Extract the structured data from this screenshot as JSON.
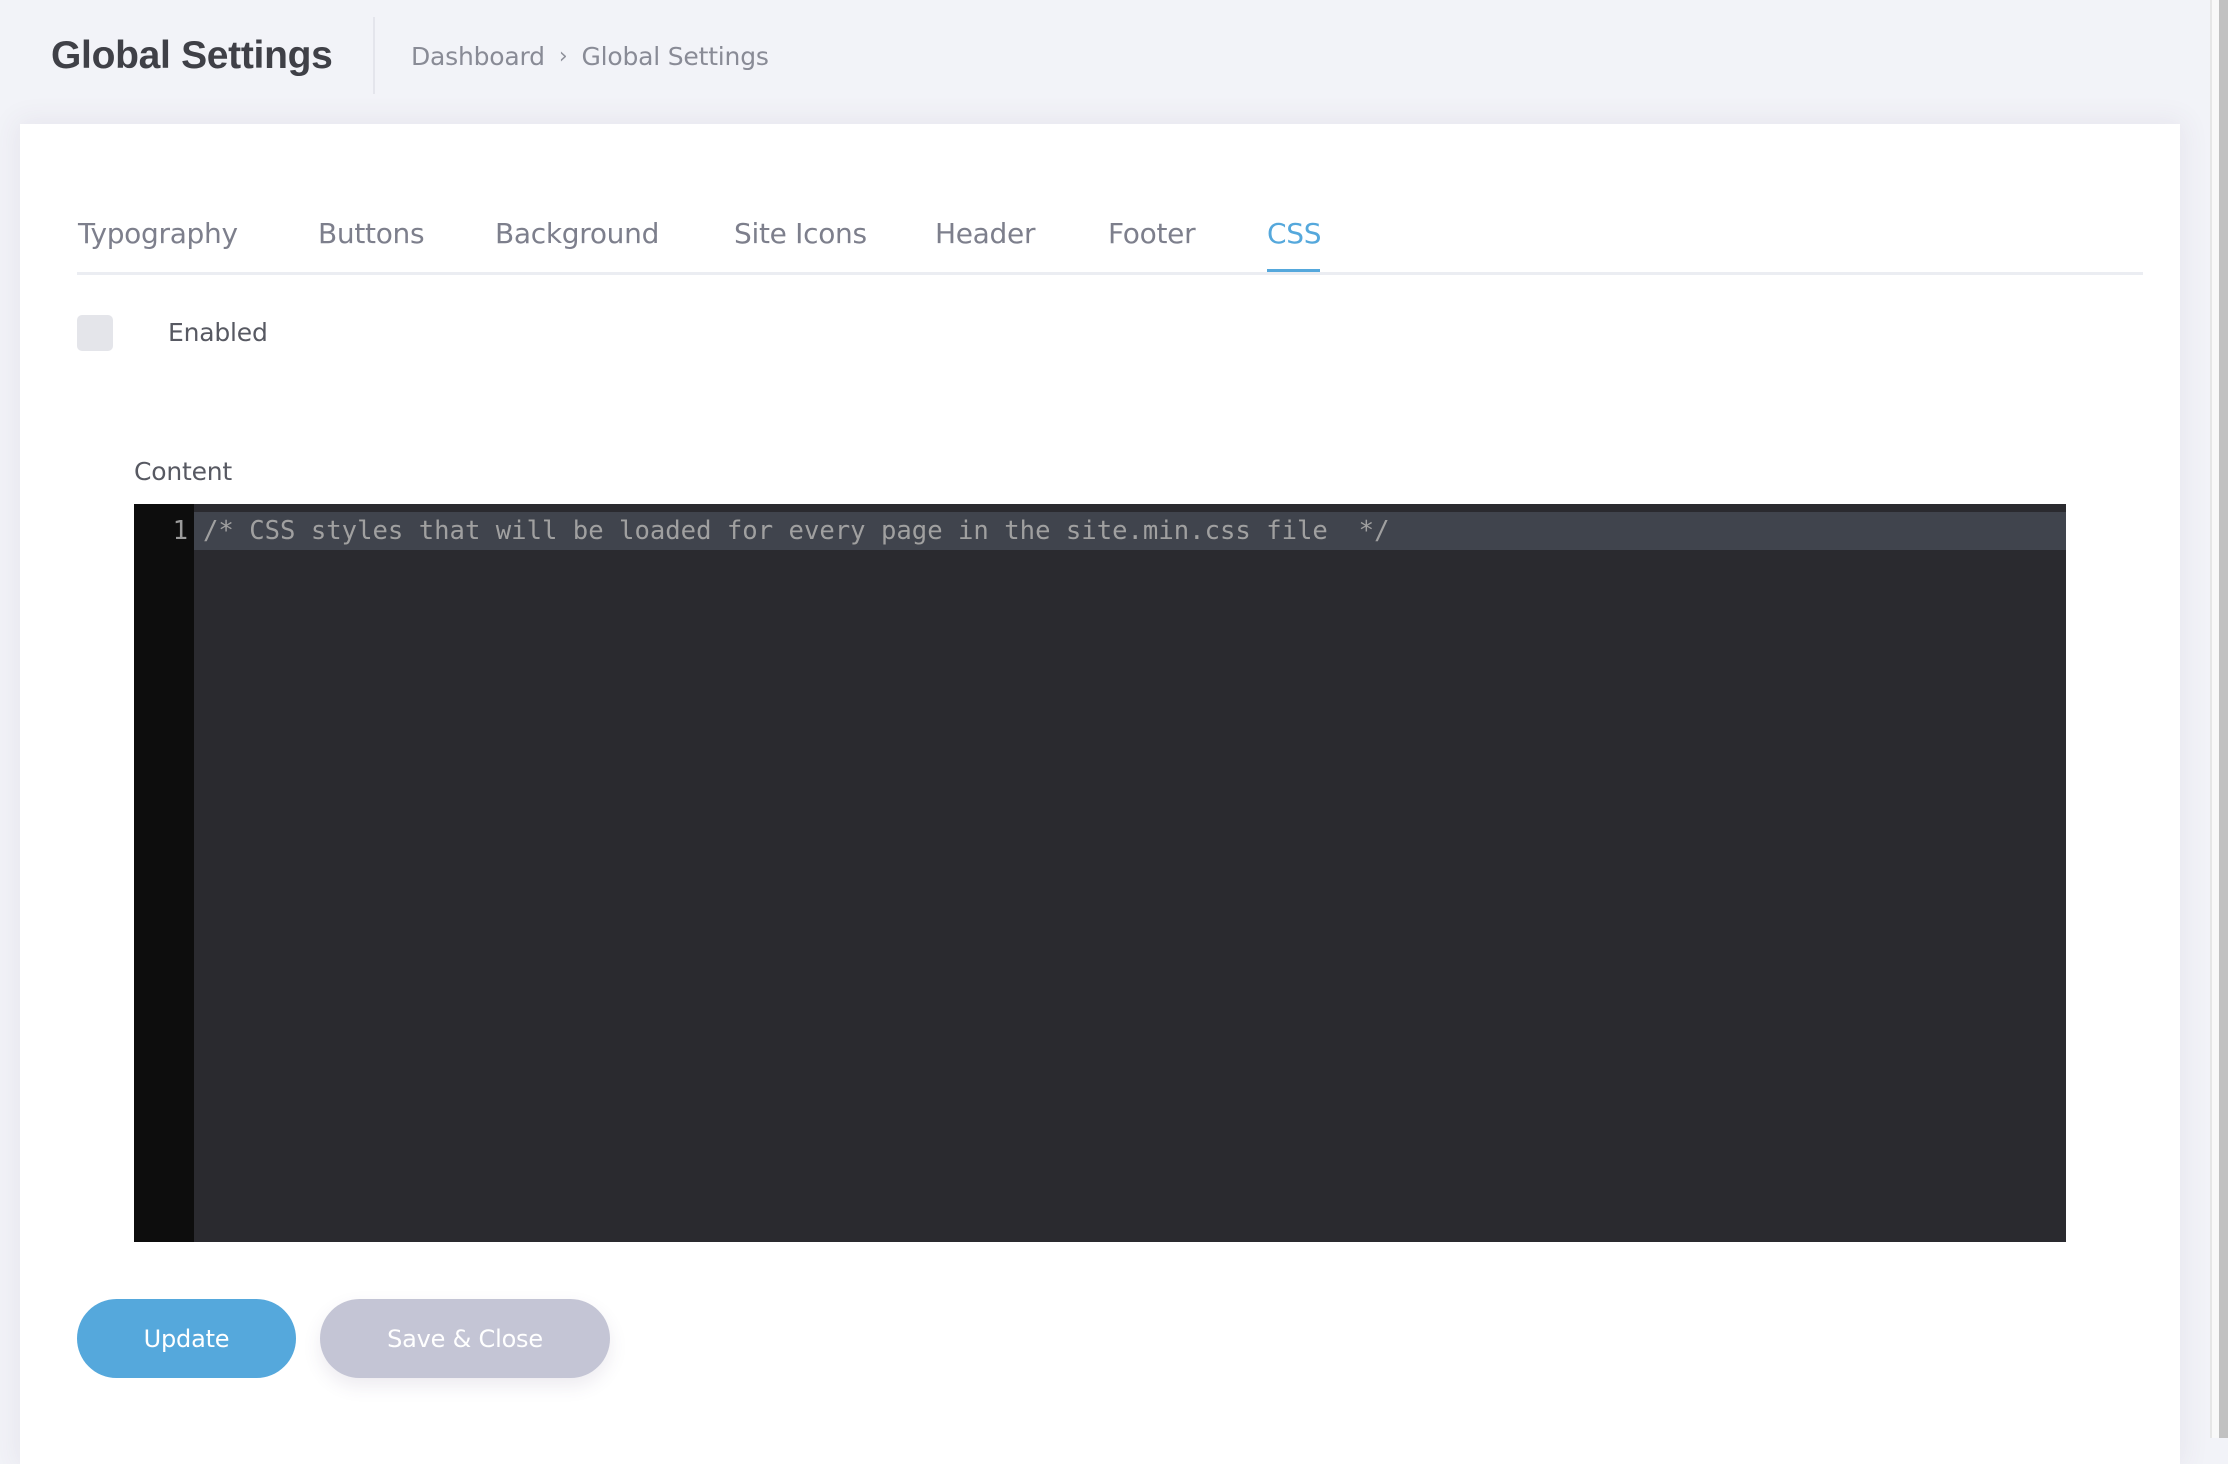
{
  "header": {
    "title": "Global Settings",
    "breadcrumb": [
      {
        "label": "Dashboard"
      },
      {
        "label": "Global Settings"
      }
    ],
    "breadcrumb_separator": "›"
  },
  "tabs": [
    {
      "label": "Typography",
      "active": false
    },
    {
      "label": "Buttons",
      "active": false
    },
    {
      "label": "Background",
      "active": false
    },
    {
      "label": "Site Icons",
      "active": false
    },
    {
      "label": "Header",
      "active": false
    },
    {
      "label": "Footer",
      "active": false
    },
    {
      "label": "CSS",
      "active": true
    }
  ],
  "form": {
    "enabled_label": "Enabled",
    "enabled_checked": false,
    "content_label": "Content",
    "editor": {
      "line_numbers": [
        "1"
      ],
      "lines": [
        "/* CSS styles that will be loaded for every page in the site.min.css file  */"
      ]
    }
  },
  "actions": {
    "update_label": "Update",
    "save_close_label": "Save & Close"
  },
  "colors": {
    "accent": "#55a8dc",
    "secondary_button": "#c4c5d5",
    "background": "#f2f3f8",
    "editor_background": "#2a2a2f"
  }
}
